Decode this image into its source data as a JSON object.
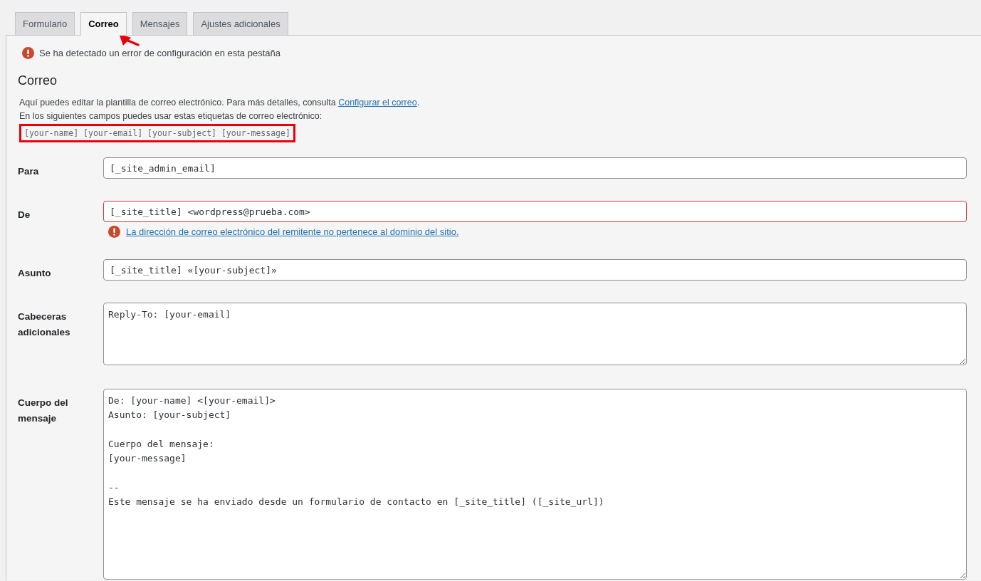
{
  "tabs": [
    {
      "label": "Formulario",
      "selected": false
    },
    {
      "label": "Correo",
      "selected": true
    },
    {
      "label": "Mensajes",
      "selected": false
    },
    {
      "label": "Ajustes adicionales",
      "selected": false
    }
  ],
  "notice": "Se ha detectado un error de configuración en esta pestaña",
  "section": {
    "title": "Correo",
    "description_before": "Aquí puedes editar la plantilla de correo electrónico. Para más detalles, consulta ",
    "description_link": "Configurar el correo",
    "description_after": ".",
    "tags_intro": "En los siguientes campos puedes usar estas etiquetas de correo electrónico:",
    "tags": "[your-name] [your-email] [your-subject] [your-message]",
    "tags_highlighted": true
  },
  "fields": [
    {
      "kind": "input",
      "label": "Para",
      "value": "[_site_admin_email]",
      "error": false
    },
    {
      "kind": "input",
      "label": "De",
      "value": "[_site_title] <wordpress@prueba.com>",
      "error": true,
      "error_message": "La dirección de correo electrónico del remitente no pertenece al dominio del sitio."
    },
    {
      "kind": "input",
      "label": "Asunto",
      "value": "[_site_title] «[your-subject]»",
      "error": false
    },
    {
      "kind": "textarea",
      "label": "Cabeceras adicionales",
      "value": "Reply-To: [your-email]",
      "error": false
    },
    {
      "kind": "body",
      "label": "Cuerpo del mensaje",
      "value": "De: [your-name] <[your-email]>\nAsunto: [your-subject]\n\nCuerpo del mensaje:\n[your-message]\n\n--\nEste mensaje se ha enviado desde un formulario de contacto en [_site_title] ([_site_url])",
      "error": false
    }
  ]
}
